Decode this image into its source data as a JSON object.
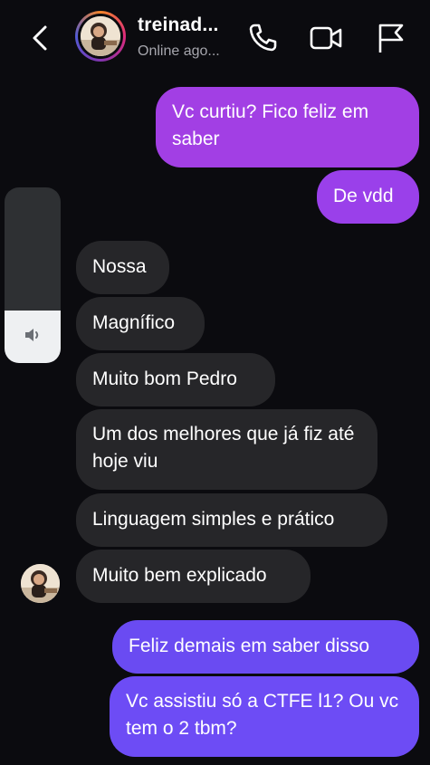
{
  "header": {
    "contact_name": "treinad...",
    "status_text": "Online ago..."
  },
  "icons": {
    "back": "chevron-left-icon",
    "call": "phone-icon",
    "video": "video-camera-icon",
    "report": "flag-icon",
    "volume": "speaker-icon"
  },
  "volume_hud": {
    "level": 0.3
  },
  "colors": {
    "background": "#0b0b0f",
    "incoming_bubble": "#262629",
    "outgoing_top": "#a23fe4",
    "outgoing_bottom": "#6d4cf5"
  },
  "messages": [
    {
      "sender": "me",
      "text": "Vc curtiu? Fico feliz em saber"
    },
    {
      "sender": "me",
      "text": "De vdd"
    },
    {
      "sender": "them",
      "text": "Nossa"
    },
    {
      "sender": "them",
      "text": "Magnífico"
    },
    {
      "sender": "them",
      "text": "Muito bom Pedro"
    },
    {
      "sender": "them",
      "text": "Um dos melhores que já fiz até hoje viu"
    },
    {
      "sender": "them",
      "text": "Linguagem simples e prático"
    },
    {
      "sender": "them",
      "text": "Muito bem explicado"
    },
    {
      "sender": "me",
      "text": "Feliz demais em saber disso"
    },
    {
      "sender": "me",
      "text": "Vc assistiu só a CTFE l1? Ou vc tem o 2 tbm?"
    }
  ]
}
